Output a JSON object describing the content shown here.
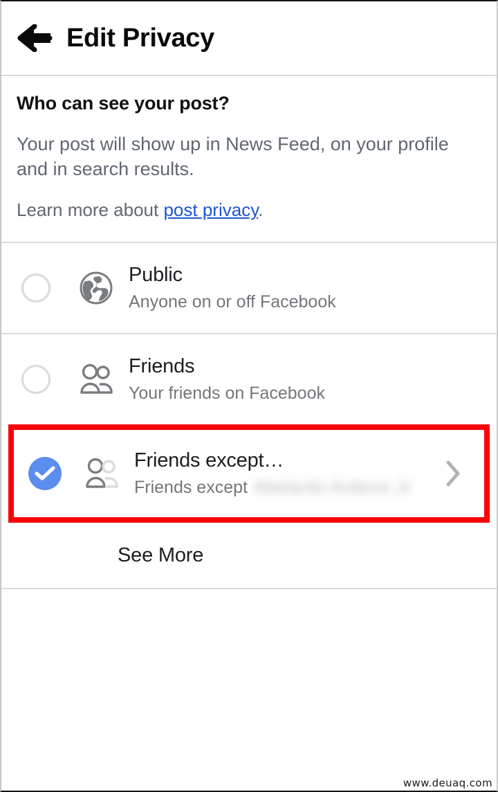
{
  "header": {
    "back_icon": "arrow-left-icon",
    "title": "Edit Privacy"
  },
  "intro": {
    "title": "Who can see your post?",
    "description": "Your post will show up in News Feed, on your profile and in search results.",
    "learn_prefix": "Learn more about ",
    "learn_link": "post privacy",
    "learn_suffix": ".",
    "link_color": "#1a55d0"
  },
  "options": [
    {
      "id": "public",
      "title": "Public",
      "subtitle": "Anyone on or off Facebook",
      "icon": "globe-icon",
      "selected": false,
      "chevron": false
    },
    {
      "id": "friends",
      "title": "Friends",
      "subtitle": "Your friends on Facebook",
      "icon": "two-people-icon",
      "selected": false,
      "chevron": false
    },
    {
      "id": "friends-except",
      "title": "Friends except…",
      "subtitle": "Friends except",
      "subtitle_redacted": "Abelardo Acibron Jr",
      "icon": "person-except-icon",
      "selected": true,
      "chevron": true,
      "highlighted": true,
      "highlight_color": "#fb0007"
    }
  ],
  "see_more": {
    "label": "See More"
  },
  "selected_color": "#5b8def",
  "watermark": {
    "text": "www.deuaq.com"
  }
}
